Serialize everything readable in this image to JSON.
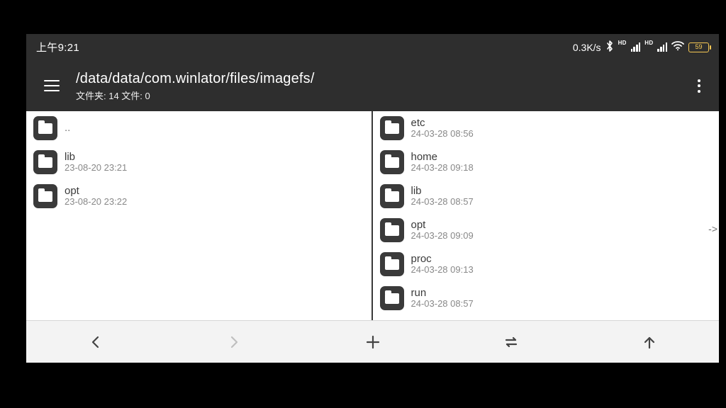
{
  "statusbar": {
    "time": "上午9:21",
    "net_speed": "0.3K/s",
    "battery": "59",
    "hd_label": "HD"
  },
  "appbar": {
    "path": "/data/data/com.winlator/files/imagefs/",
    "subtitle": "文件夹: 14  文件: 0"
  },
  "left_pane": {
    "items": [
      {
        "name": "..",
        "date": ""
      },
      {
        "name": "lib",
        "date": "23-08-20 23:21"
      },
      {
        "name": "opt",
        "date": "23-08-20 23:22"
      }
    ]
  },
  "right_pane": {
    "items": [
      {
        "name": "etc",
        "date": "24-03-28 08:56"
      },
      {
        "name": "home",
        "date": "24-03-28 09:18"
      },
      {
        "name": "lib",
        "date": "24-03-28 08:57"
      },
      {
        "name": "opt",
        "date": "24-03-28 09:09"
      },
      {
        "name": "proc",
        "date": "24-03-28 09:13"
      },
      {
        "name": "run",
        "date": "24-03-28 08:57"
      }
    ]
  },
  "edge_hint": "->"
}
